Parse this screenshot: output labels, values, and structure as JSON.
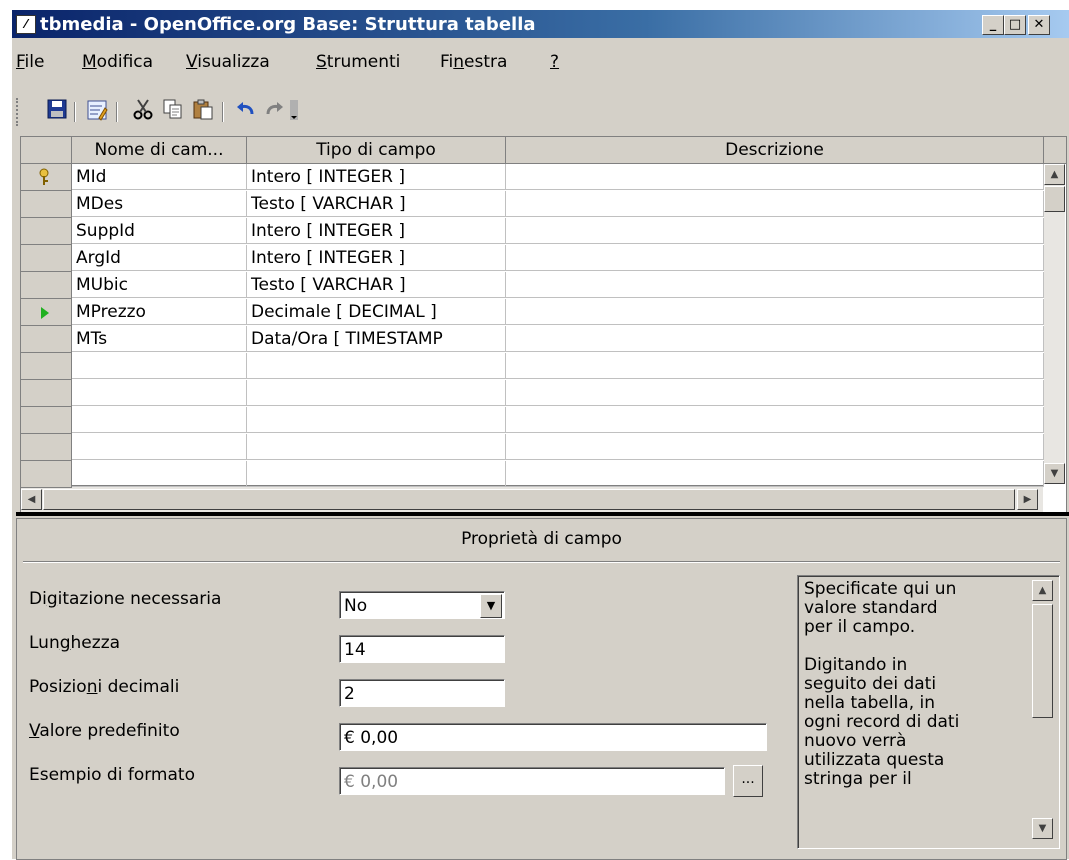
{
  "window": {
    "title": "tbmedia - OpenOffice.org Base: Struttura tabella"
  },
  "menu": [
    {
      "pre": "",
      "u": "F",
      "post": "ile"
    },
    {
      "pre": "",
      "u": "M",
      "post": "odifica"
    },
    {
      "pre": "",
      "u": "V",
      "post": "isualizza"
    },
    {
      "pre": "",
      "u": "S",
      "post": "trumenti"
    },
    {
      "pre": "Fi",
      "u": "n",
      "post": "estra"
    },
    {
      "pre": "",
      "u": "?",
      "post": ""
    }
  ],
  "grid": {
    "headers": [
      "Nome di cam...",
      "Tipo di campo",
      "Descrizione"
    ],
    "rows": [
      {
        "name": "MId",
        "type": "Intero [ INTEGER ]",
        "desc": ""
      },
      {
        "name": "MDes",
        "type": "Testo [ VARCHAR ]",
        "desc": ""
      },
      {
        "name": "SuppId",
        "type": "Intero [ INTEGER ]",
        "desc": ""
      },
      {
        "name": "ArgId",
        "type": "Intero [ INTEGER ]",
        "desc": ""
      },
      {
        "name": "MUbic",
        "type": "Testo [ VARCHAR ]",
        "desc": ""
      },
      {
        "name": "MPrezzo",
        "type": "Decimale [ DECIMAL ]",
        "desc": ""
      },
      {
        "name": "MTs",
        "type": "Data/Ora [ TIMESTAMP",
        "desc": ""
      }
    ]
  },
  "props": {
    "title": "Proprietà di campo",
    "required": {
      "pre": "Di",
      "u": "g",
      "post": "itazione necessaria",
      "value": "No"
    },
    "length": {
      "pre": "Lun",
      "u": "g",
      "post": "hezza",
      "value": "14"
    },
    "decimals": {
      "pre": "Posizio",
      "u": "n",
      "post": "i decimali",
      "value": "2"
    },
    "default": {
      "pre": "",
      "u": "V",
      "post": "alore predefinito",
      "value": "€ 0,00"
    },
    "format": {
      "label": "Esempio di formato",
      "value": "€ 0,00",
      "button": "..."
    },
    "help": "Specificate qui un\nvalore standard\nper il campo.\n\nDigitando in\nseguito dei dati\nnella tabella, in\nogni record di dati\nnuovo verrà\nutilizzata questa\nstringa per il"
  },
  "icons": {
    "save": "save-icon",
    "edit": "edit-icon",
    "cut": "cut-icon",
    "copy": "copy-icon",
    "paste": "paste-icon",
    "undo": "undo-icon",
    "redo": "redo-icon",
    "primary_key": "key-icon",
    "current_row": "row-pointer-icon"
  }
}
